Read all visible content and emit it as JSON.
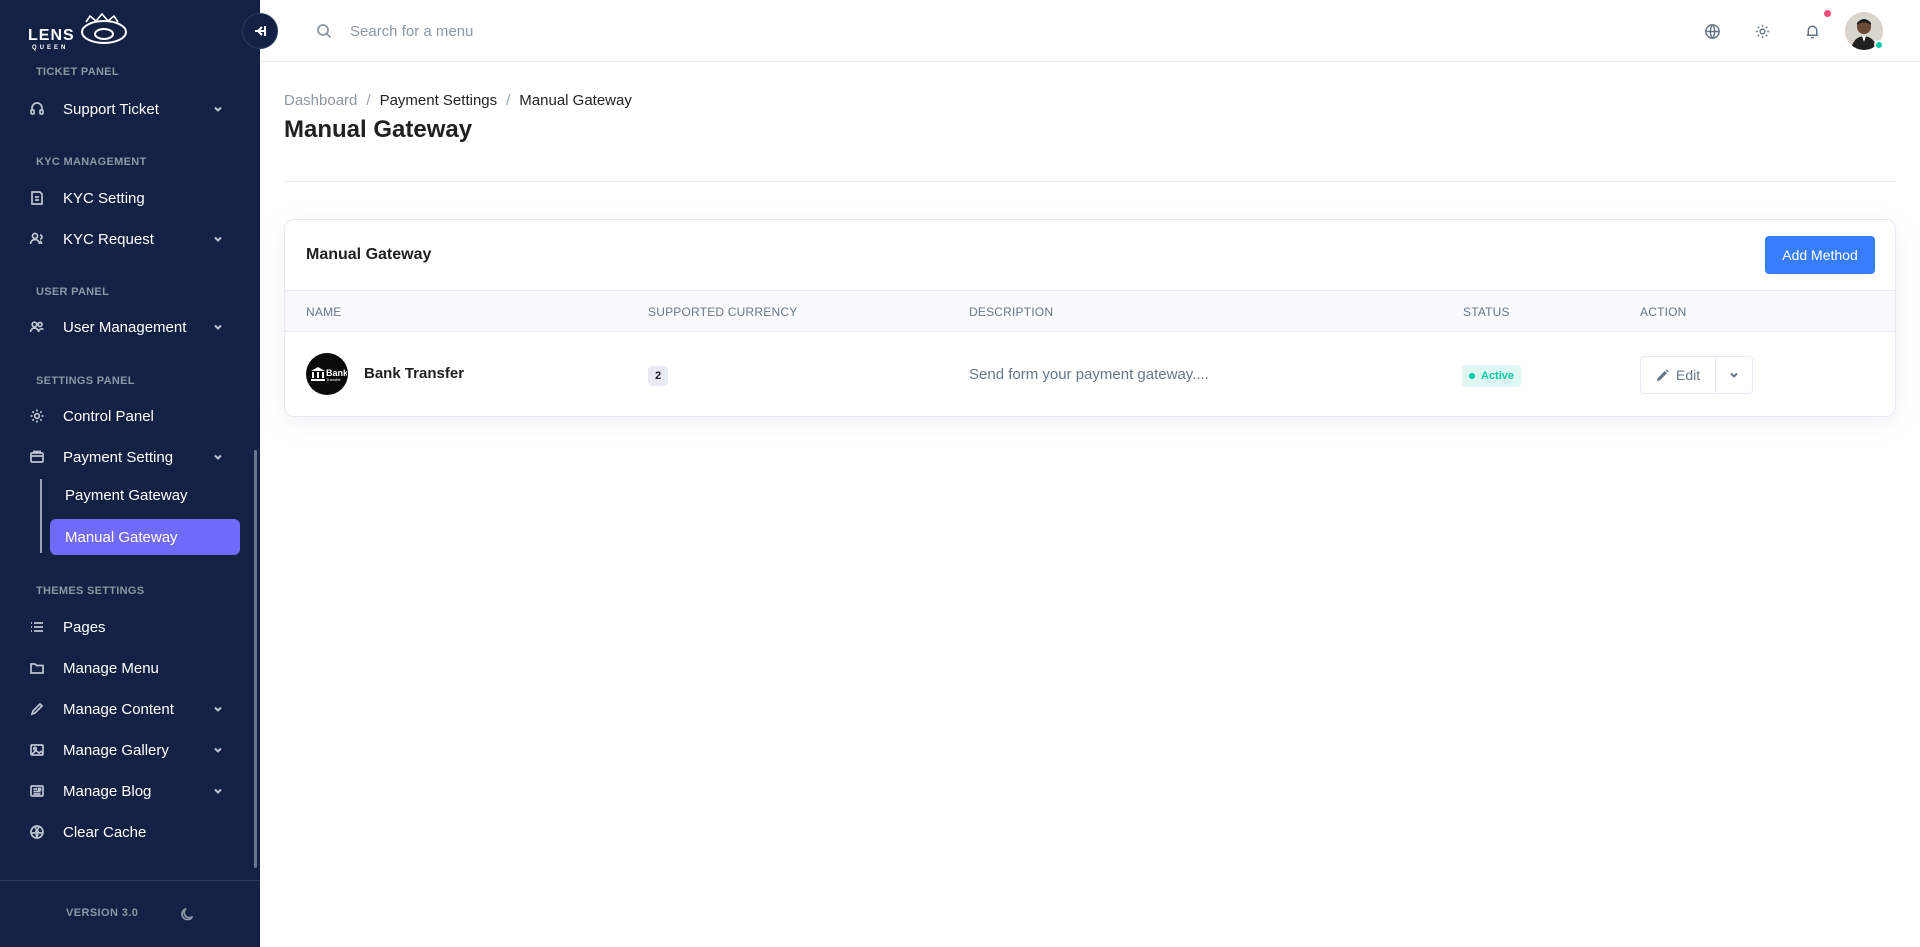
{
  "app": {
    "logo_text": "LENS QUEEN"
  },
  "sidebar": {
    "sections": [
      {
        "title": "TICKET PANEL"
      },
      {
        "title": "KYC MANAGEMENT"
      },
      {
        "title": "USER PANEL"
      },
      {
        "title": "SETTINGS PANEL"
      },
      {
        "title": "THEMES SETTINGS"
      }
    ],
    "items": [
      {
        "label": "Support Ticket",
        "icon": "headset-icon"
      },
      {
        "label": "KYC Setting",
        "icon": "document-icon"
      },
      {
        "label": "KYC Request",
        "icon": "users-icon"
      },
      {
        "label": "User Management",
        "icon": "user-group-icon"
      },
      {
        "label": "Control Panel",
        "icon": "gear-icon"
      },
      {
        "label": "Payment Setting",
        "icon": "wallet-icon"
      },
      {
        "label": "Pages",
        "icon": "list-icon"
      },
      {
        "label": "Manage Menu",
        "icon": "folder-icon"
      },
      {
        "label": "Manage Content",
        "icon": "pencil-icon"
      },
      {
        "label": "Manage Gallery",
        "icon": "image-icon"
      },
      {
        "label": "Manage Blog",
        "icon": "newspaper-icon"
      },
      {
        "label": "Clear Cache",
        "icon": "radiation-icon"
      }
    ],
    "sub_items": [
      {
        "label": "Payment Gateway"
      },
      {
        "label": "Manual Gateway",
        "active": true
      }
    ],
    "version": "VERSION 3.0"
  },
  "header": {
    "search_placeholder": "Search for a menu"
  },
  "page": {
    "breadcrumb": [
      "Dashboard",
      "Payment Settings",
      "Manual Gateway"
    ],
    "title": "Manual Gateway"
  },
  "card": {
    "title": "Manual Gateway",
    "add_button": "Add Method",
    "columns": [
      "NAME",
      "SUPPORTED CURRENCY",
      "DESCRIPTION",
      "STATUS",
      "ACTION"
    ],
    "rows": [
      {
        "logo_text": "Bank",
        "logo_subtext": "Transfer",
        "name": "Bank Transfer",
        "currency_count": "2",
        "description": "Send form your payment gateway....",
        "status": "Active",
        "action": "Edit"
      }
    ]
  },
  "colors": {
    "sidebar_bg": "#132144",
    "active_item": "#6f6af8",
    "primary": "#377dff",
    "success": "#00c9a7",
    "notification": "#ed4c78"
  }
}
